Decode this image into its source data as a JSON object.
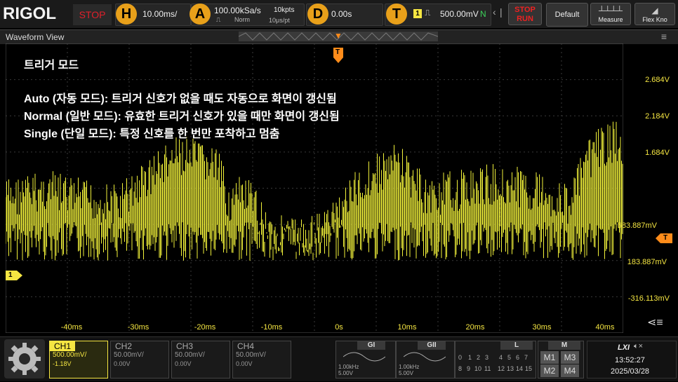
{
  "brand": "RIGOL",
  "run_state": "STOP",
  "horizontal": {
    "letter": "H",
    "timebase": "10.00ms/"
  },
  "acquire": {
    "letter": "A",
    "sample_rate": "100.00kSa/s",
    "points": "10kpts",
    "mode": "Norm",
    "interval": "10μs/pt"
  },
  "delay": {
    "letter": "D",
    "value": "0.00s"
  },
  "trigger": {
    "letter": "T",
    "source_badge": "1",
    "level": "500.00mV",
    "coupling_mark": "N"
  },
  "buttons": {
    "stop_top": "STOP",
    "stop_bottom": "RUN",
    "default": "Default",
    "measure": "Measure",
    "flex_knob": "Flex Kno"
  },
  "waveform_view": {
    "title": "Waveform View"
  },
  "overlay": {
    "title": "트리거 모드",
    "line1": "Auto (자동 모드): 트리거 신호가 없을 때도 자동으로 화면이 갱신됨",
    "line2": "Normal (일반 모드): 유효한 트리거 신호가 있을 때만 화면이 갱신됨",
    "line3": "Single (단일 모드): 특정 신호를 한 번만 포착하고 멈춤"
  },
  "y_labels": [
    "2.684V",
    "2.184V",
    "1.684V",
    "683.887mV",
    "183.887mV",
    "-316.113mV"
  ],
  "x_labels": [
    "-40ms",
    "-30ms",
    "-20ms",
    "-10ms",
    "0s",
    "10ms",
    "20ms",
    "30ms",
    "40ms"
  ],
  "markers": {
    "trigger_top": "T",
    "trigger_level": "T",
    "channel1": "1"
  },
  "colors": {
    "ch1": "#f5e642",
    "accent": "#e8a01a",
    "trigger": "#ff8c1a",
    "stop": "#e0202a"
  },
  "channels": [
    {
      "name": "CH1",
      "scale": "500.00mV/",
      "offset": "-1.18V",
      "active": true
    },
    {
      "name": "CH2",
      "scale": "50.00mV/",
      "offset": "0.00V",
      "active": false
    },
    {
      "name": "CH3",
      "scale": "50.00mV/",
      "offset": "0.00V",
      "active": false
    },
    {
      "name": "CH4",
      "scale": "50.00mV/",
      "offset": "0.00V",
      "active": false
    }
  ],
  "gi": {
    "label": "GI",
    "freq": "1.00kHz",
    "amp": "5.00V"
  },
  "gii": {
    "label": "GII",
    "freq": "1.00kHz",
    "amp": "5.00V"
  },
  "logic": {
    "label": "L",
    "row1": [
      "0",
      "1",
      "2",
      "3",
      "4",
      "5",
      "6",
      "7"
    ],
    "row2": [
      "8",
      "9",
      "10",
      "11",
      "12",
      "13",
      "14",
      "15"
    ]
  },
  "math": {
    "label": "M",
    "buttons": [
      "M1",
      "M3",
      "M2",
      "M4"
    ]
  },
  "status": {
    "lxi": "LXI",
    "time": "13:52:27",
    "date": "2025/03/28"
  }
}
